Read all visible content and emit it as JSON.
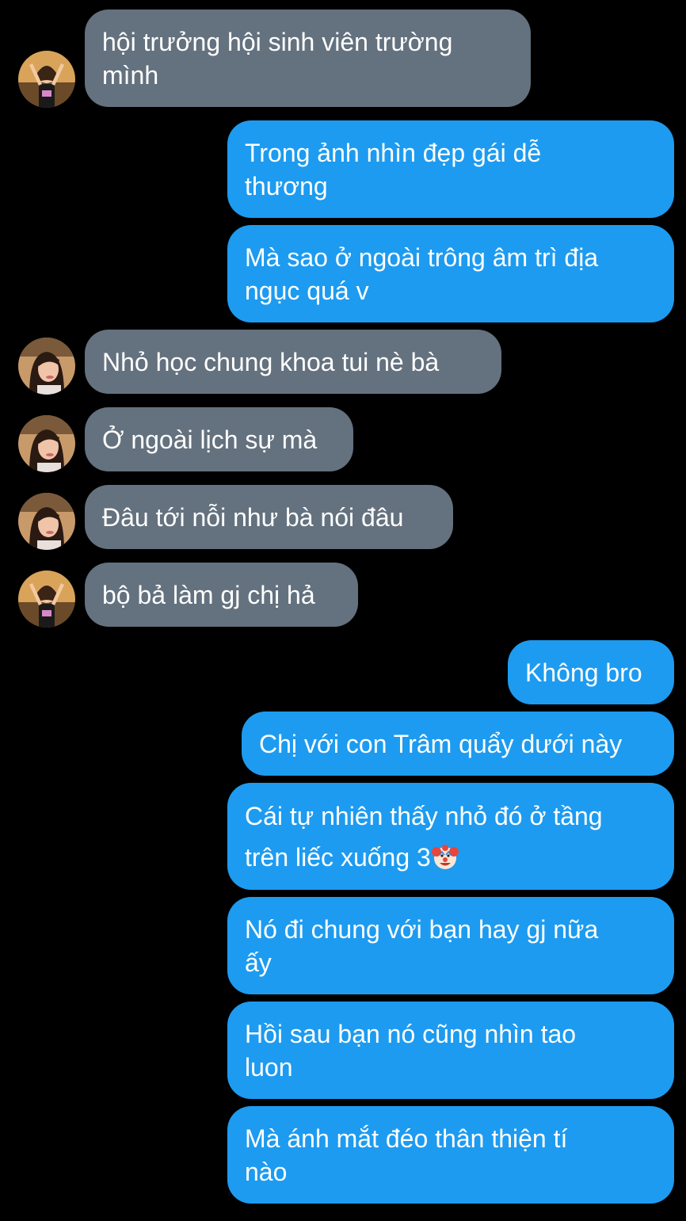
{
  "colors": {
    "background": "#000000",
    "incoming_bubble": "#64717e",
    "outgoing_bubble": "#1d9bf0",
    "text": "#ffffff"
  },
  "messages": [
    {
      "side": "in",
      "text": "hội trưởng hội sinh viên trường\nmình",
      "avatar": "avatar-arms-up"
    },
    {
      "side": "out",
      "text": "Trong ảnh nhìn đẹp gái dễ\nthương"
    },
    {
      "side": "out",
      "text": "Mà sao ở ngoài trông âm trì địa\nngục quá v"
    },
    {
      "side": "in",
      "text": "Nhỏ học chung khoa tui nè bà",
      "avatar": "avatar-selfie"
    },
    {
      "side": "in",
      "text": "Ở ngoài lịch sự mà",
      "avatar": "avatar-selfie"
    },
    {
      "side": "in",
      "text": "Đâu tới nỗi như bà nói đâu",
      "avatar": "avatar-selfie"
    },
    {
      "side": "in",
      "text": "bộ bả làm gj chị hả",
      "avatar": "avatar-arms-up"
    },
    {
      "side": "out",
      "text": "Không bro"
    },
    {
      "side": "out",
      "text": "Chị với con Trâm quẩy dưới này"
    },
    {
      "side": "out",
      "text": "Cái tự nhiên thấy nhỏ đó ở tầng\ntrên liếc xuống 3",
      "emoji": "clown-face-icon"
    },
    {
      "side": "out",
      "text": "Nó đi chung với bạn hay gj nữa\nấy"
    },
    {
      "side": "out",
      "text": "Hồi sau bạn nó cũng nhìn tao\nluon"
    },
    {
      "side": "out",
      "text": "Mà ánh mắt đéo thân thiện tí\nnào"
    }
  ]
}
